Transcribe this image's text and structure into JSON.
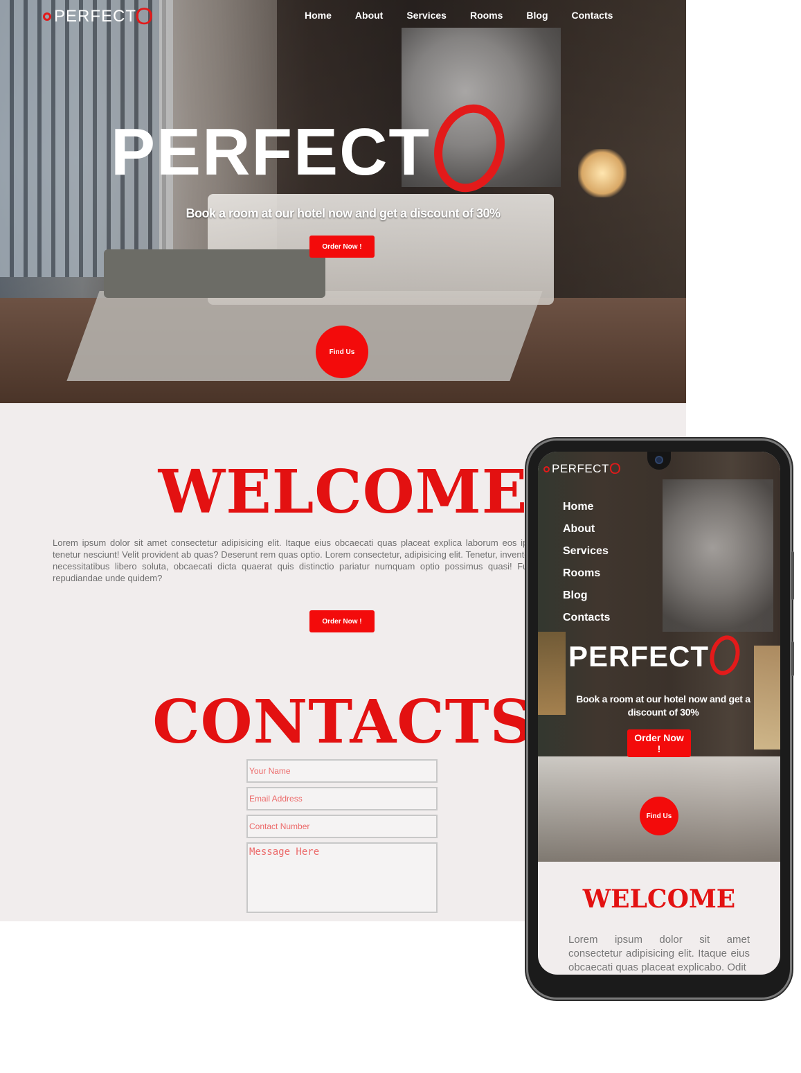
{
  "brand": {
    "name": "PERFECT",
    "accent": "#e31a1a"
  },
  "nav": [
    "Home",
    "About",
    "Services",
    "Rooms",
    "Blog",
    "Contacts"
  ],
  "hero": {
    "title": "PERFECT",
    "subtitle": "Book a room at our hotel now and get a discount of 30%",
    "order_label": "Order Now !",
    "find_label": "Find Us"
  },
  "welcome": {
    "title": "WELCOME",
    "text": "Lorem ipsum dolor sit amet consectetur adipisicing elit. Itaque eius obcaecati quas placeat explica laborum eos ipsa tenetur nesciunt! Velit provident ab quas? Deserunt rem quas optio. Lorem consectetur, adipisicing elit. Tenetur, inventore necessitatibus libero soluta, obcaecati dicta quaerat quis distinctio pariatur numquam optio possimus quasi! Fugit repudiandae unde quidem?",
    "order_label": "Order Now !"
  },
  "contacts": {
    "title": "CONTACTS",
    "name_placeholder": "Your Name",
    "email_placeholder": "Email Address",
    "phone_placeholder": "Contact Number",
    "message_placeholder": "Message Here"
  },
  "mobile": {
    "subtitle": "Book a room at our hotel now and get a discount of 30%",
    "order_label": "Order Now !",
    "find_label": "Find Us",
    "welcome_title": "WELCOME",
    "welcome_text": "Lorem ipsum dolor sit amet consectetur adipisicing elit. Itaque eius obcaecati quas placeat explicabo. Odit"
  },
  "colors": {
    "accent_red": "#f30b0b",
    "heading_red": "#e31111",
    "section_bg": "#f1eded"
  }
}
